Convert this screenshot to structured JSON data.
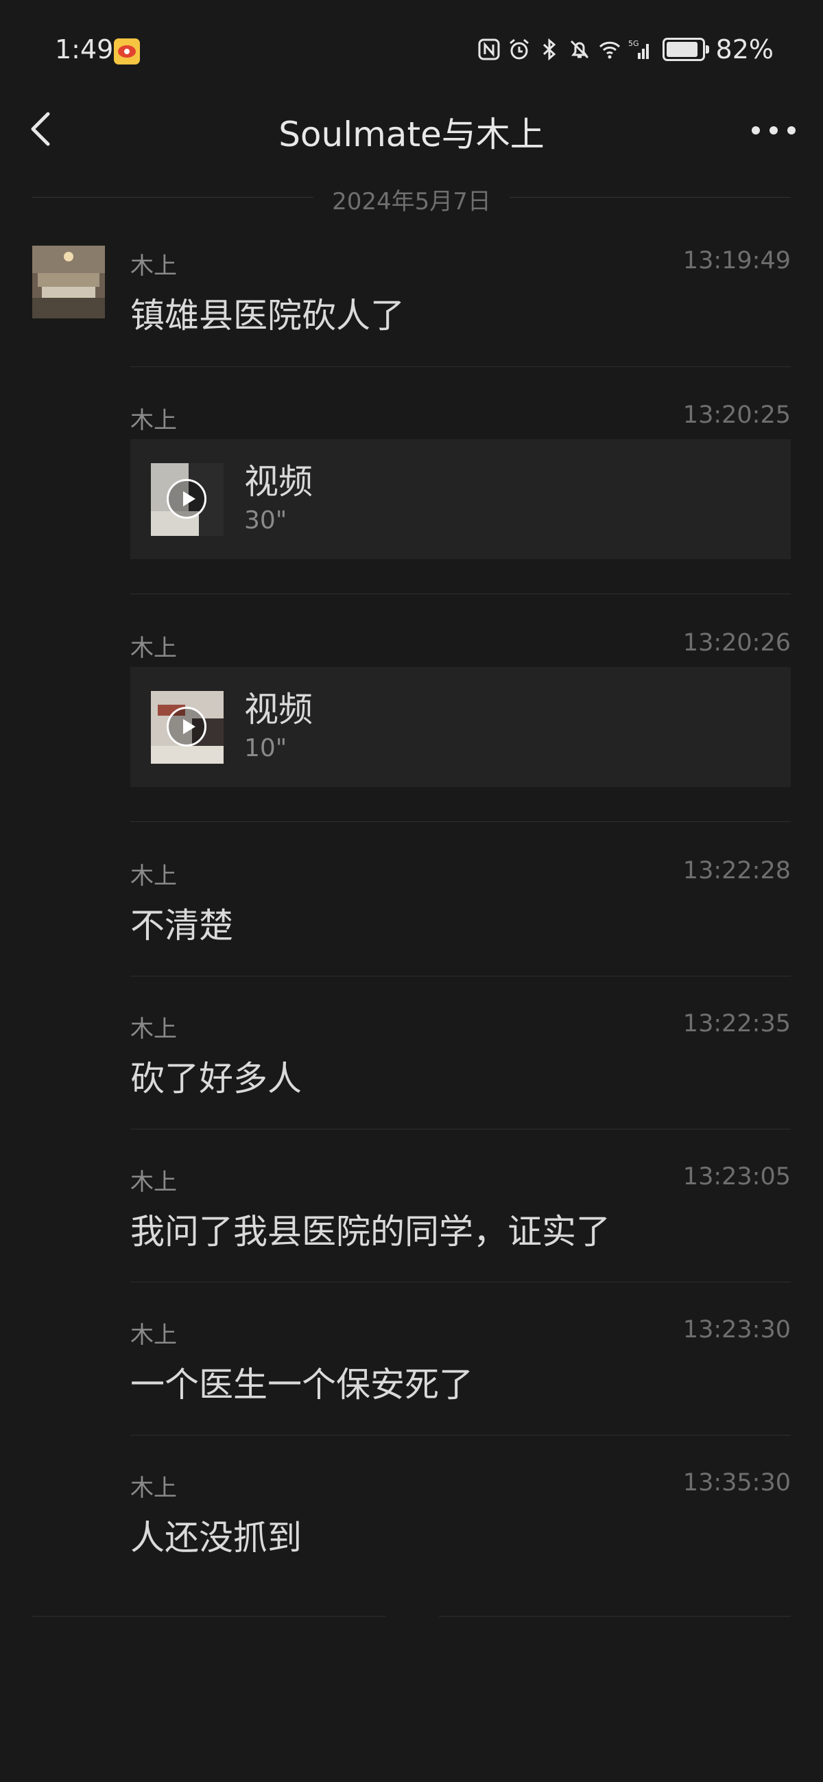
{
  "status_bar": {
    "time": "1:49",
    "battery_percent": "82%",
    "battery_level": 0.82,
    "icons": [
      "weibo-icon",
      "nfc-icon",
      "alarm-icon",
      "bluetooth-icon",
      "mute-icon",
      "wifi-icon",
      "signal-5g-icon",
      "battery-icon"
    ]
  },
  "header": {
    "title": "Soulmate与木上"
  },
  "date_divider": "2024年5月7日",
  "messages": [
    {
      "sender": "木上",
      "time": "13:19:49",
      "type": "text",
      "text": "镇雄县医院砍人了"
    },
    {
      "sender": "木上",
      "time": "13:20:25",
      "type": "video",
      "label": "视频",
      "duration": "30\""
    },
    {
      "sender": "木上",
      "time": "13:20:26",
      "type": "video",
      "label": "视频",
      "duration": "10\""
    },
    {
      "sender": "木上",
      "time": "13:22:28",
      "type": "text",
      "text": "不清楚"
    },
    {
      "sender": "木上",
      "time": "13:22:35",
      "type": "text",
      "text": "砍了好多人"
    },
    {
      "sender": "木上",
      "time": "13:23:05",
      "type": "text",
      "text": "我问了我县医院的同学，证实了"
    },
    {
      "sender": "木上",
      "time": "13:23:30",
      "type": "text",
      "text": "一个医生一个保安死了"
    },
    {
      "sender": "木上",
      "time": "13:35:30",
      "type": "text",
      "text": "人还没抓到"
    }
  ]
}
